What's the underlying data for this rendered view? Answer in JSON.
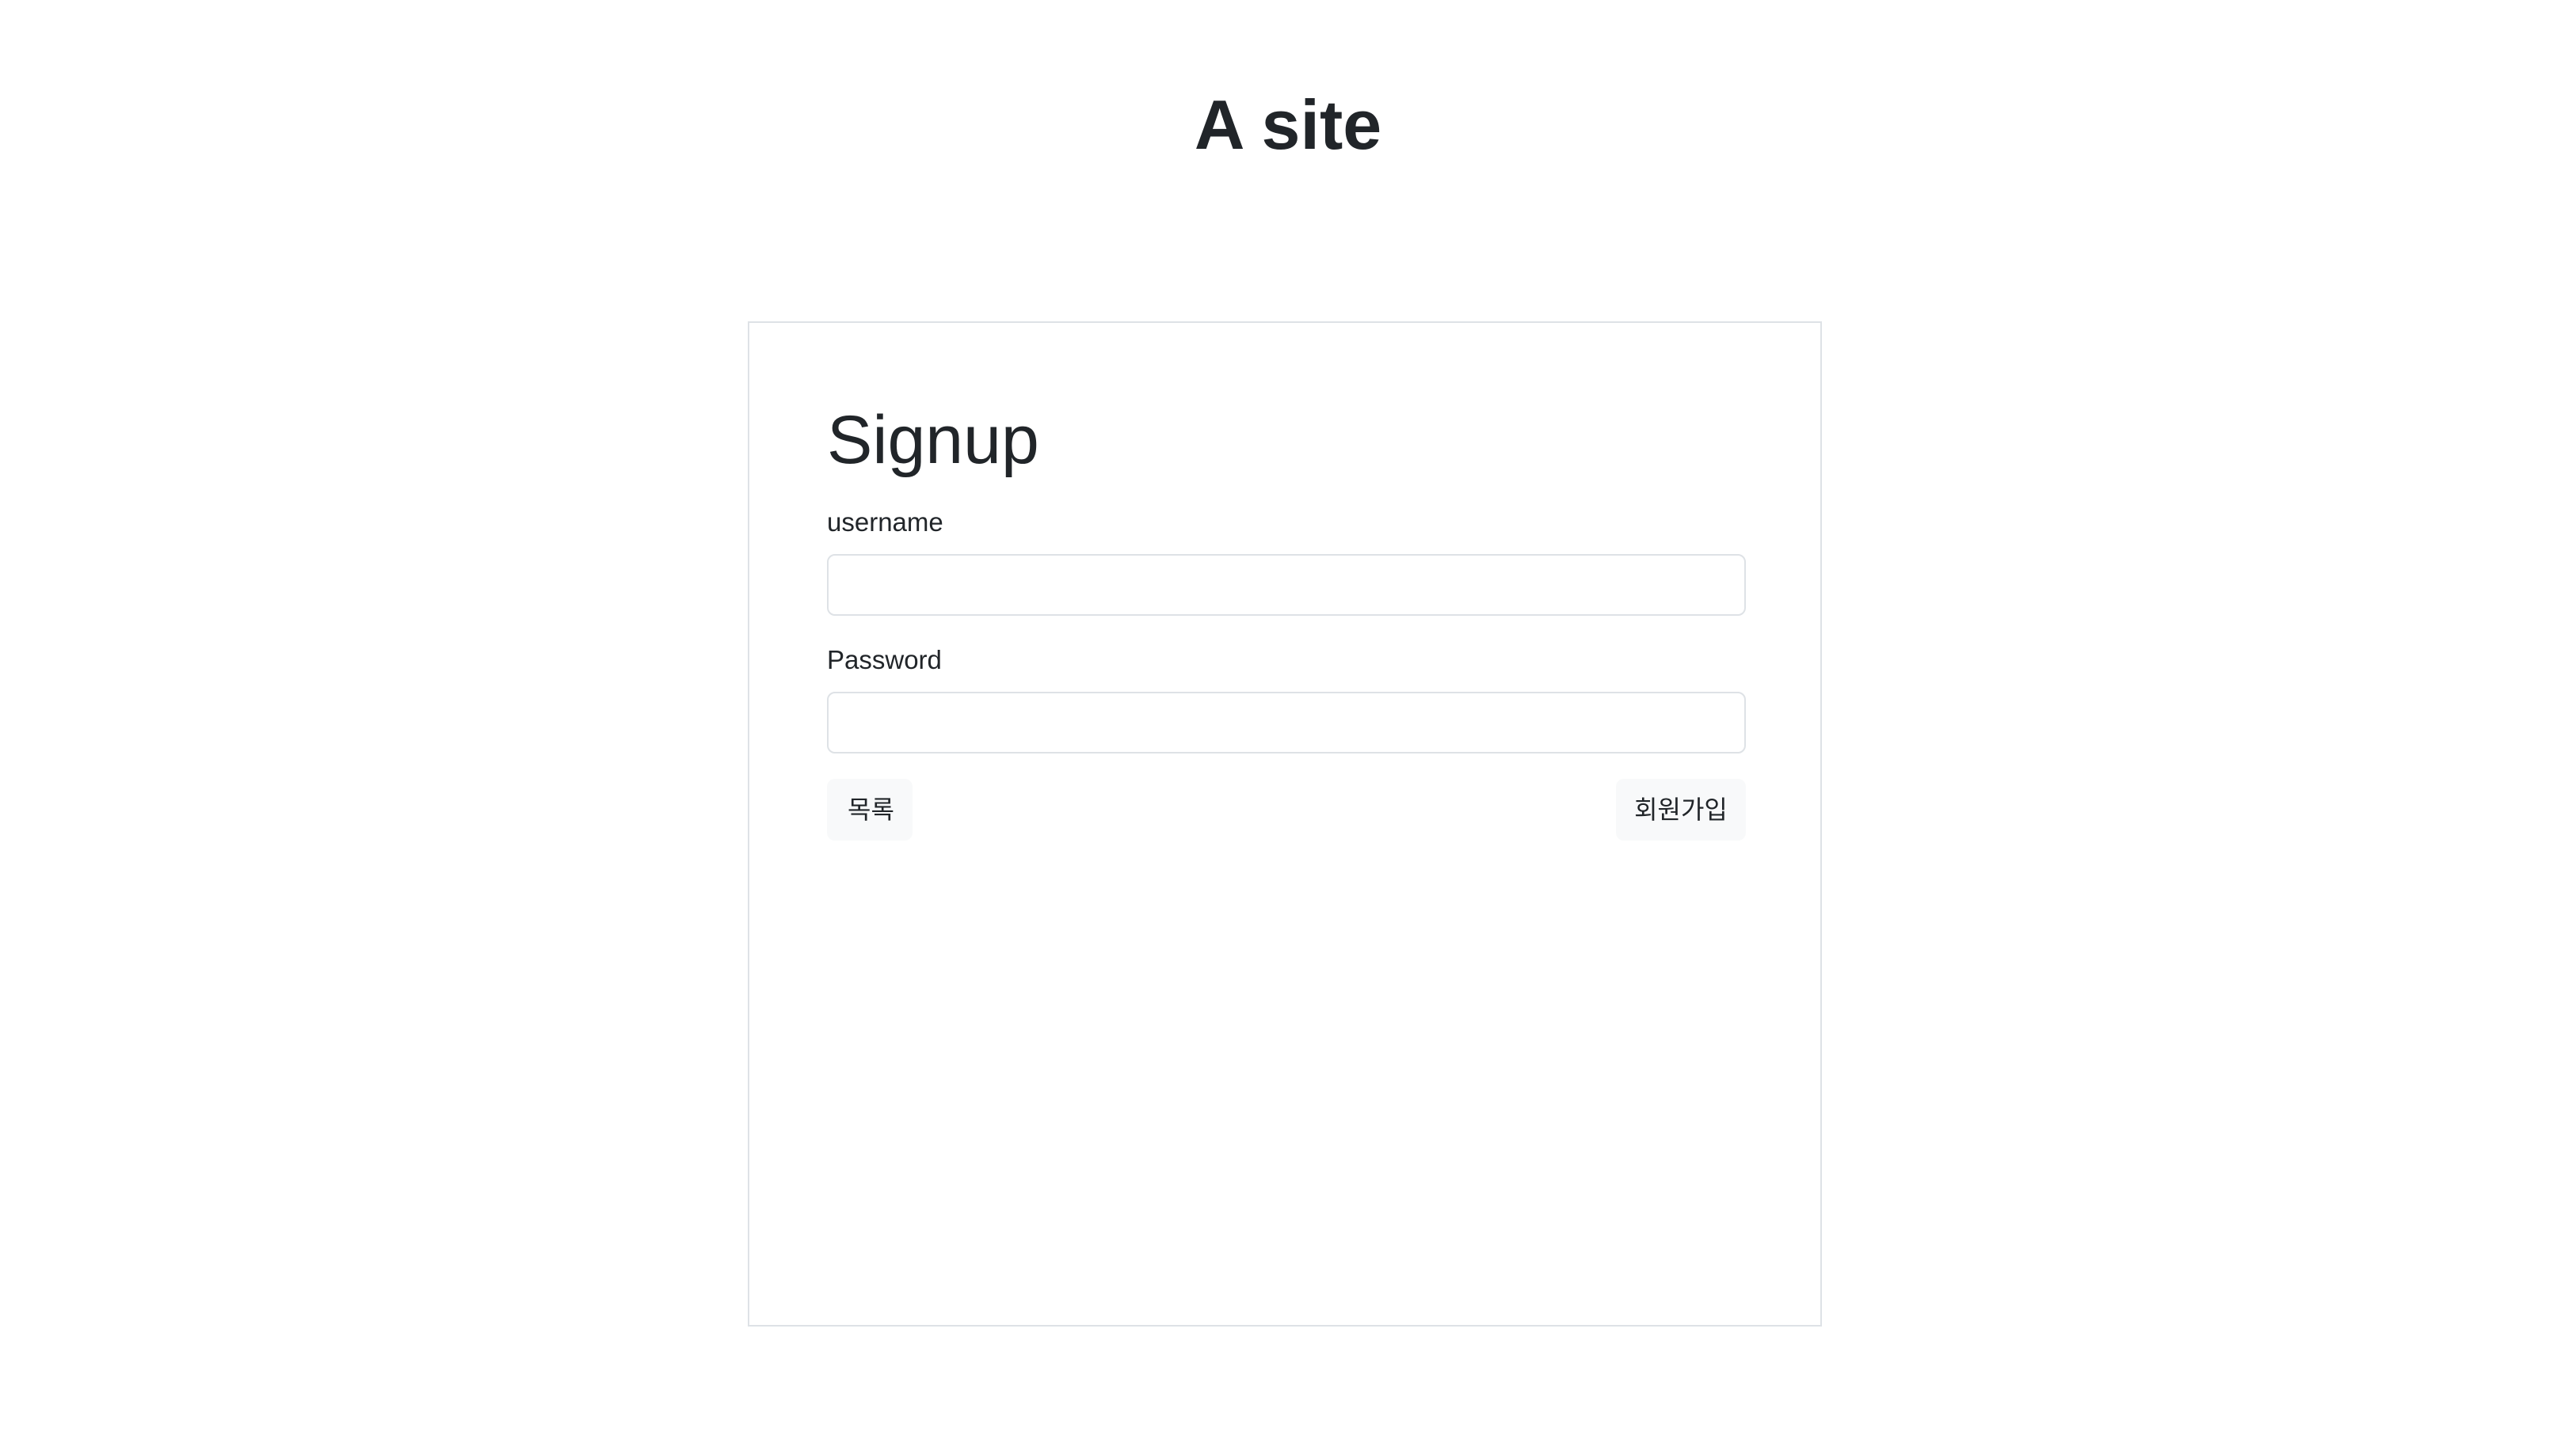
{
  "header": {
    "site_title": "A site"
  },
  "signup_form": {
    "title": "Signup",
    "username_label": "username",
    "username_value": "",
    "password_label": "Password",
    "password_value": "",
    "list_button_label": "목록",
    "signup_button_label": "회원가입"
  },
  "colors": {
    "text": "#212529",
    "border": "#dee2e6",
    "button_background": "#f8f9fa",
    "page_background": "#ffffff"
  }
}
